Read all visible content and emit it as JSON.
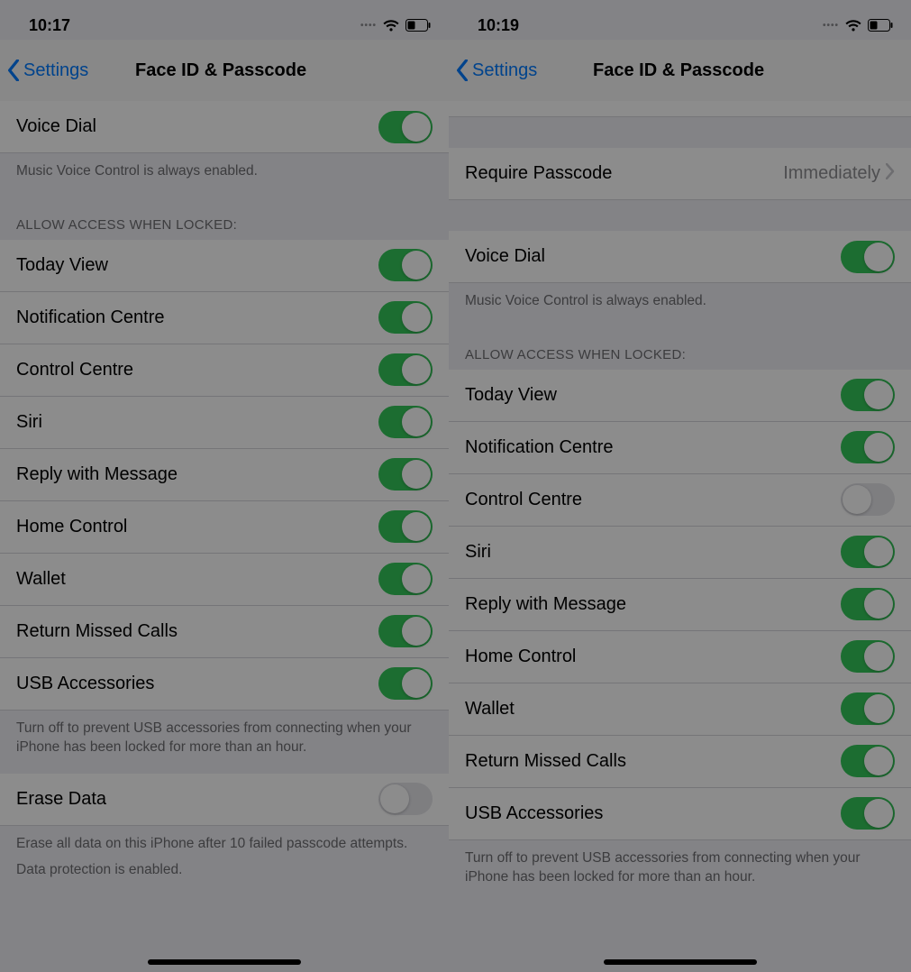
{
  "left": {
    "status": {
      "time": "10:17"
    },
    "nav": {
      "back": "Settings",
      "title": "Face ID & Passcode"
    },
    "voiceDial": {
      "label": "Voice Dial",
      "footer": "Music Voice Control is always enabled."
    },
    "sectionHeader": "Allow Access When Locked:",
    "rows": {
      "todayView": "Today View",
      "notificationCentre": "Notification Centre",
      "controlCentre": "Control Centre",
      "siri": "Siri",
      "replyWithMessage": "Reply with Message",
      "homeControl": "Home Control",
      "wallet": "Wallet",
      "returnMissedCalls": "Return Missed Calls",
      "usbAccessories": "USB Accessories"
    },
    "usbFooter": "Turn off to prevent USB accessories from connecting when your iPhone has been locked for more than an hour.",
    "eraseData": {
      "label": "Erase Data",
      "footer1": "Erase all data on this iPhone after 10 failed passcode attempts.",
      "footer2": "Data protection is enabled."
    }
  },
  "right": {
    "status": {
      "time": "10:19"
    },
    "nav": {
      "back": "Settings",
      "title": "Face ID & Passcode"
    },
    "requirePasscode": {
      "label": "Require Passcode",
      "value": "Immediately"
    },
    "voiceDial": {
      "label": "Voice Dial",
      "footer": "Music Voice Control is always enabled."
    },
    "sectionHeader": "Allow Access When Locked:",
    "rows": {
      "todayView": "Today View",
      "notificationCentre": "Notification Centre",
      "controlCentre": "Control Centre",
      "siri": "Siri",
      "replyWithMessage": "Reply with Message",
      "homeControl": "Home Control",
      "wallet": "Wallet",
      "returnMissedCalls": "Return Missed Calls",
      "usbAccessories": "USB Accessories"
    },
    "usbFooter": "Turn off to prevent USB accessories from connecting when your iPhone has been locked for more than an hour."
  }
}
